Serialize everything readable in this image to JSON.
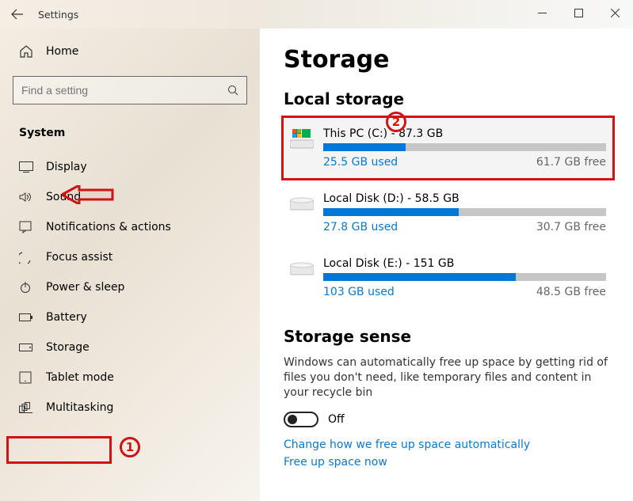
{
  "window": {
    "title": "Settings"
  },
  "sidebar": {
    "home": "Home",
    "search_placeholder": "Find a setting",
    "group": "System",
    "items": [
      {
        "icon": "display-icon",
        "label": "Display"
      },
      {
        "icon": "sound-icon",
        "label": "Sound"
      },
      {
        "icon": "notifications-icon",
        "label": "Notifications & actions"
      },
      {
        "icon": "focus-assist-icon",
        "label": "Focus assist"
      },
      {
        "icon": "power-sleep-icon",
        "label": "Power & sleep"
      },
      {
        "icon": "battery-icon",
        "label": "Battery"
      },
      {
        "icon": "storage-icon",
        "label": "Storage"
      },
      {
        "icon": "tablet-mode-icon",
        "label": "Tablet mode"
      },
      {
        "icon": "multitasking-icon",
        "label": "Multitasking"
      }
    ]
  },
  "main": {
    "title": "Storage",
    "local_storage_header": "Local storage",
    "drives": [
      {
        "name": "This PC (C:) - 87.3 GB",
        "used": "25.5 GB used",
        "free": "61.7 GB free",
        "pct": 29,
        "primary": true
      },
      {
        "name": "Local Disk (D:) - 58.5 GB",
        "used": "27.8 GB used",
        "free": "30.7 GB free",
        "pct": 48,
        "primary": false
      },
      {
        "name": "Local Disk (E:) - 151 GB",
        "used": "103 GB used",
        "free": "48.5 GB free",
        "pct": 68,
        "primary": false
      }
    ],
    "sense_header": "Storage sense",
    "sense_desc": "Windows can automatically free up space by getting rid of files you don't need, like temporary files and content in your recycle bin",
    "sense_toggle": "Off",
    "link_change": "Change how we free up space automatically",
    "link_free": "Free up space now"
  },
  "annotations": {
    "marker1": "1",
    "marker2": "2"
  }
}
